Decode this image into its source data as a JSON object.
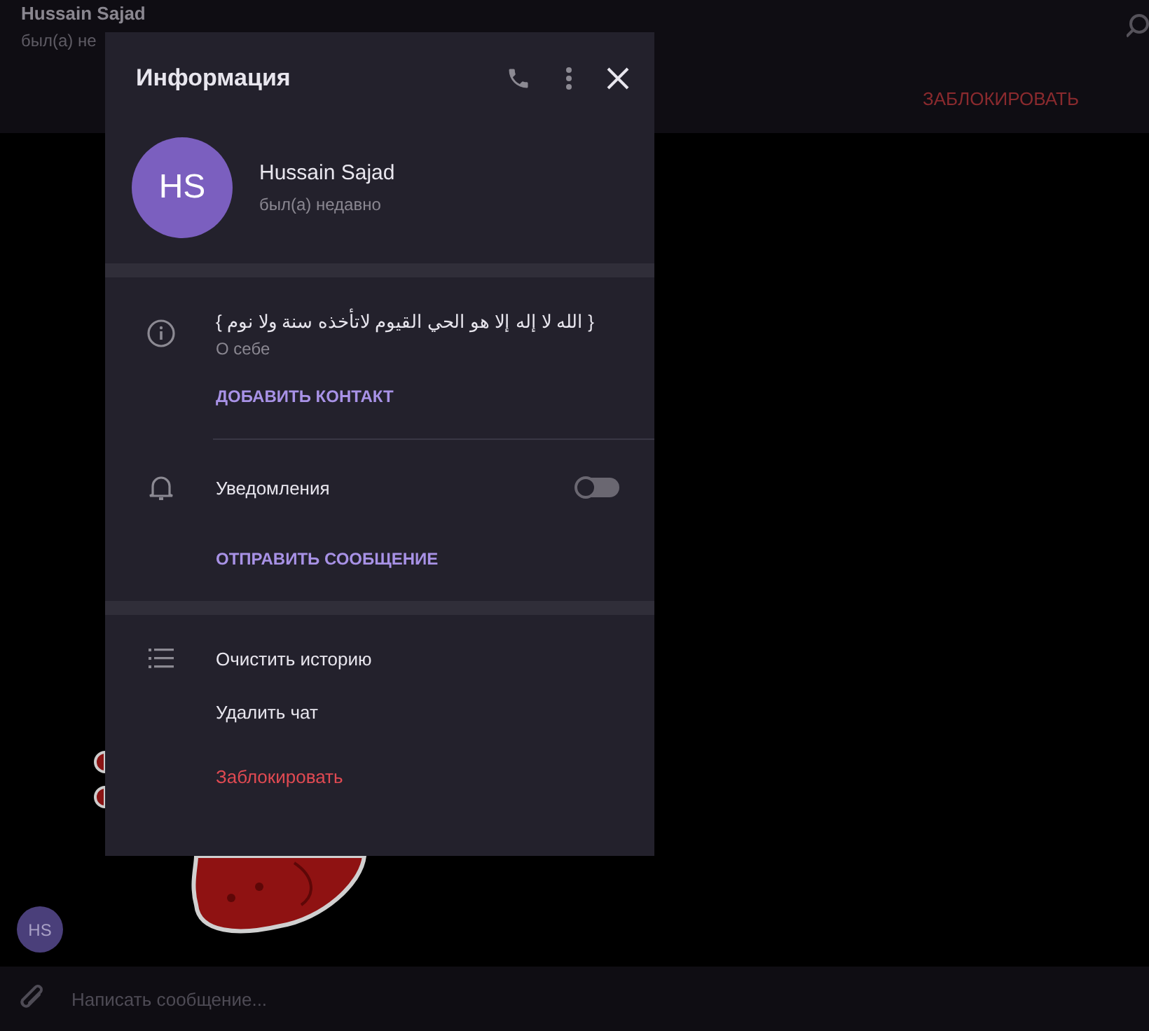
{
  "chat_header": {
    "name": "Hussain Sajad",
    "status": "был(а) не",
    "block_button": "ЗАБЛОКИРОВАТЬ"
  },
  "chat": {
    "sender_avatar": "HS",
    "composer": {
      "placeholder": "Написать сообщение..."
    }
  },
  "info_dialog": {
    "title": "Информация",
    "profile": {
      "initials": "HS",
      "name": "Hussain Sajad",
      "status": "был(а) недавно"
    },
    "about": {
      "text": "{ الله لا إله إلا هو الحي القيوم لاتأخذه سنة ولا نوم }",
      "caption": "О себе"
    },
    "add_contact": "ДОБАВИТЬ КОНТАКТ",
    "notifications": {
      "label": "Уведомления",
      "on": false
    },
    "send_message": "ОТПРАВИТЬ СООБЩЕНИЕ",
    "actions": [
      {
        "label": "Очистить историю",
        "kind": "normal"
      },
      {
        "label": "Удалить чат",
        "kind": "normal"
      },
      {
        "label": "Заблокировать",
        "kind": "danger"
      }
    ]
  }
}
